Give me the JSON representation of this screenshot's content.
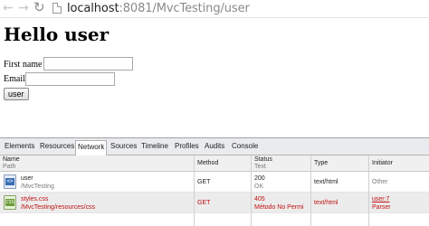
{
  "browser": {
    "url_host": "localhost",
    "url_rest": ":8081/MvcTesting/user"
  },
  "page": {
    "heading": "Hello user",
    "first_name_label": "First name",
    "email_label": "Email",
    "submit_label": "user"
  },
  "devtools": {
    "tabs": [
      "Elements",
      "Resources",
      "Network",
      "Sources",
      "Timeline",
      "Profiles",
      "Audits",
      "Console"
    ],
    "active_tab": "Network",
    "columns": {
      "name": "Name",
      "name_sub": "Path",
      "method": "Method",
      "status": "Status",
      "status_sub": "Text",
      "type": "Type",
      "initiator": "Initiator"
    },
    "rows": [
      {
        "name": "user",
        "path": "/MvcTesting",
        "method": "GET",
        "status": "200",
        "status_text": "OK",
        "type": "text/html",
        "initiator": "Other",
        "initiator_sub": "",
        "icon": "html-document-icon",
        "error": false
      },
      {
        "name": "styles.css",
        "path": "/MvcTesting/resources/css",
        "method": "GET",
        "status": "405",
        "status_text": "Método No Permi",
        "type": "text/html",
        "initiator": "user:7",
        "initiator_sub": "Parser",
        "icon": "css-file-icon",
        "error": true
      }
    ]
  },
  "colors": {
    "error": "#c01010",
    "toolbar_bg": "#e9ebee"
  }
}
